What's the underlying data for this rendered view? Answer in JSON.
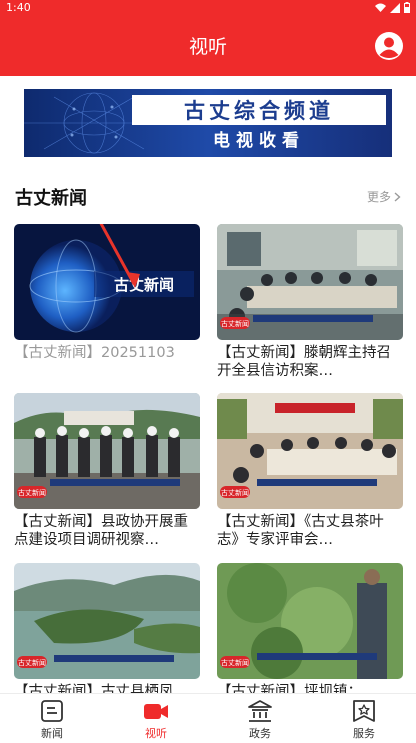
{
  "status": {
    "time": "1:40"
  },
  "header": {
    "title": "视听"
  },
  "banner": {
    "line1": "古丈综合频道",
    "line2": "电视收看"
  },
  "section": {
    "title": "古丈新闻",
    "more": "更多"
  },
  "cards": [
    {
      "caption": "【古丈新闻】20251103",
      "thumb_logo": "古丈新闻"
    },
    {
      "caption": "【古丈新闻】滕朝辉主持召开全县信访积案…",
      "thumb_logo": "古丈新闻"
    },
    {
      "caption": "【古丈新闻】县政协开展重点建设项目调研视察…",
      "thumb_logo": "古丈新闻"
    },
    {
      "caption": "【古丈新闻】《古丈县茶叶志》专家评审会…",
      "thumb_logo": "古丈新闻"
    },
    {
      "caption": "【古丈新闻】古丈县栖凤…",
      "thumb_logo": "古丈新闻"
    },
    {
      "caption": "【古丈新闻】坪坝镇：…",
      "thumb_logo": "古丈新闻"
    }
  ],
  "tabs": [
    {
      "label": "新闻",
      "icon": "news-icon"
    },
    {
      "label": "视听",
      "icon": "video-icon"
    },
    {
      "label": "政务",
      "icon": "government-icon"
    },
    {
      "label": "服务",
      "icon": "service-icon"
    }
  ],
  "colors": {
    "accent": "#ef2b2b",
    "banner_blue": "#1c3d8f"
  }
}
